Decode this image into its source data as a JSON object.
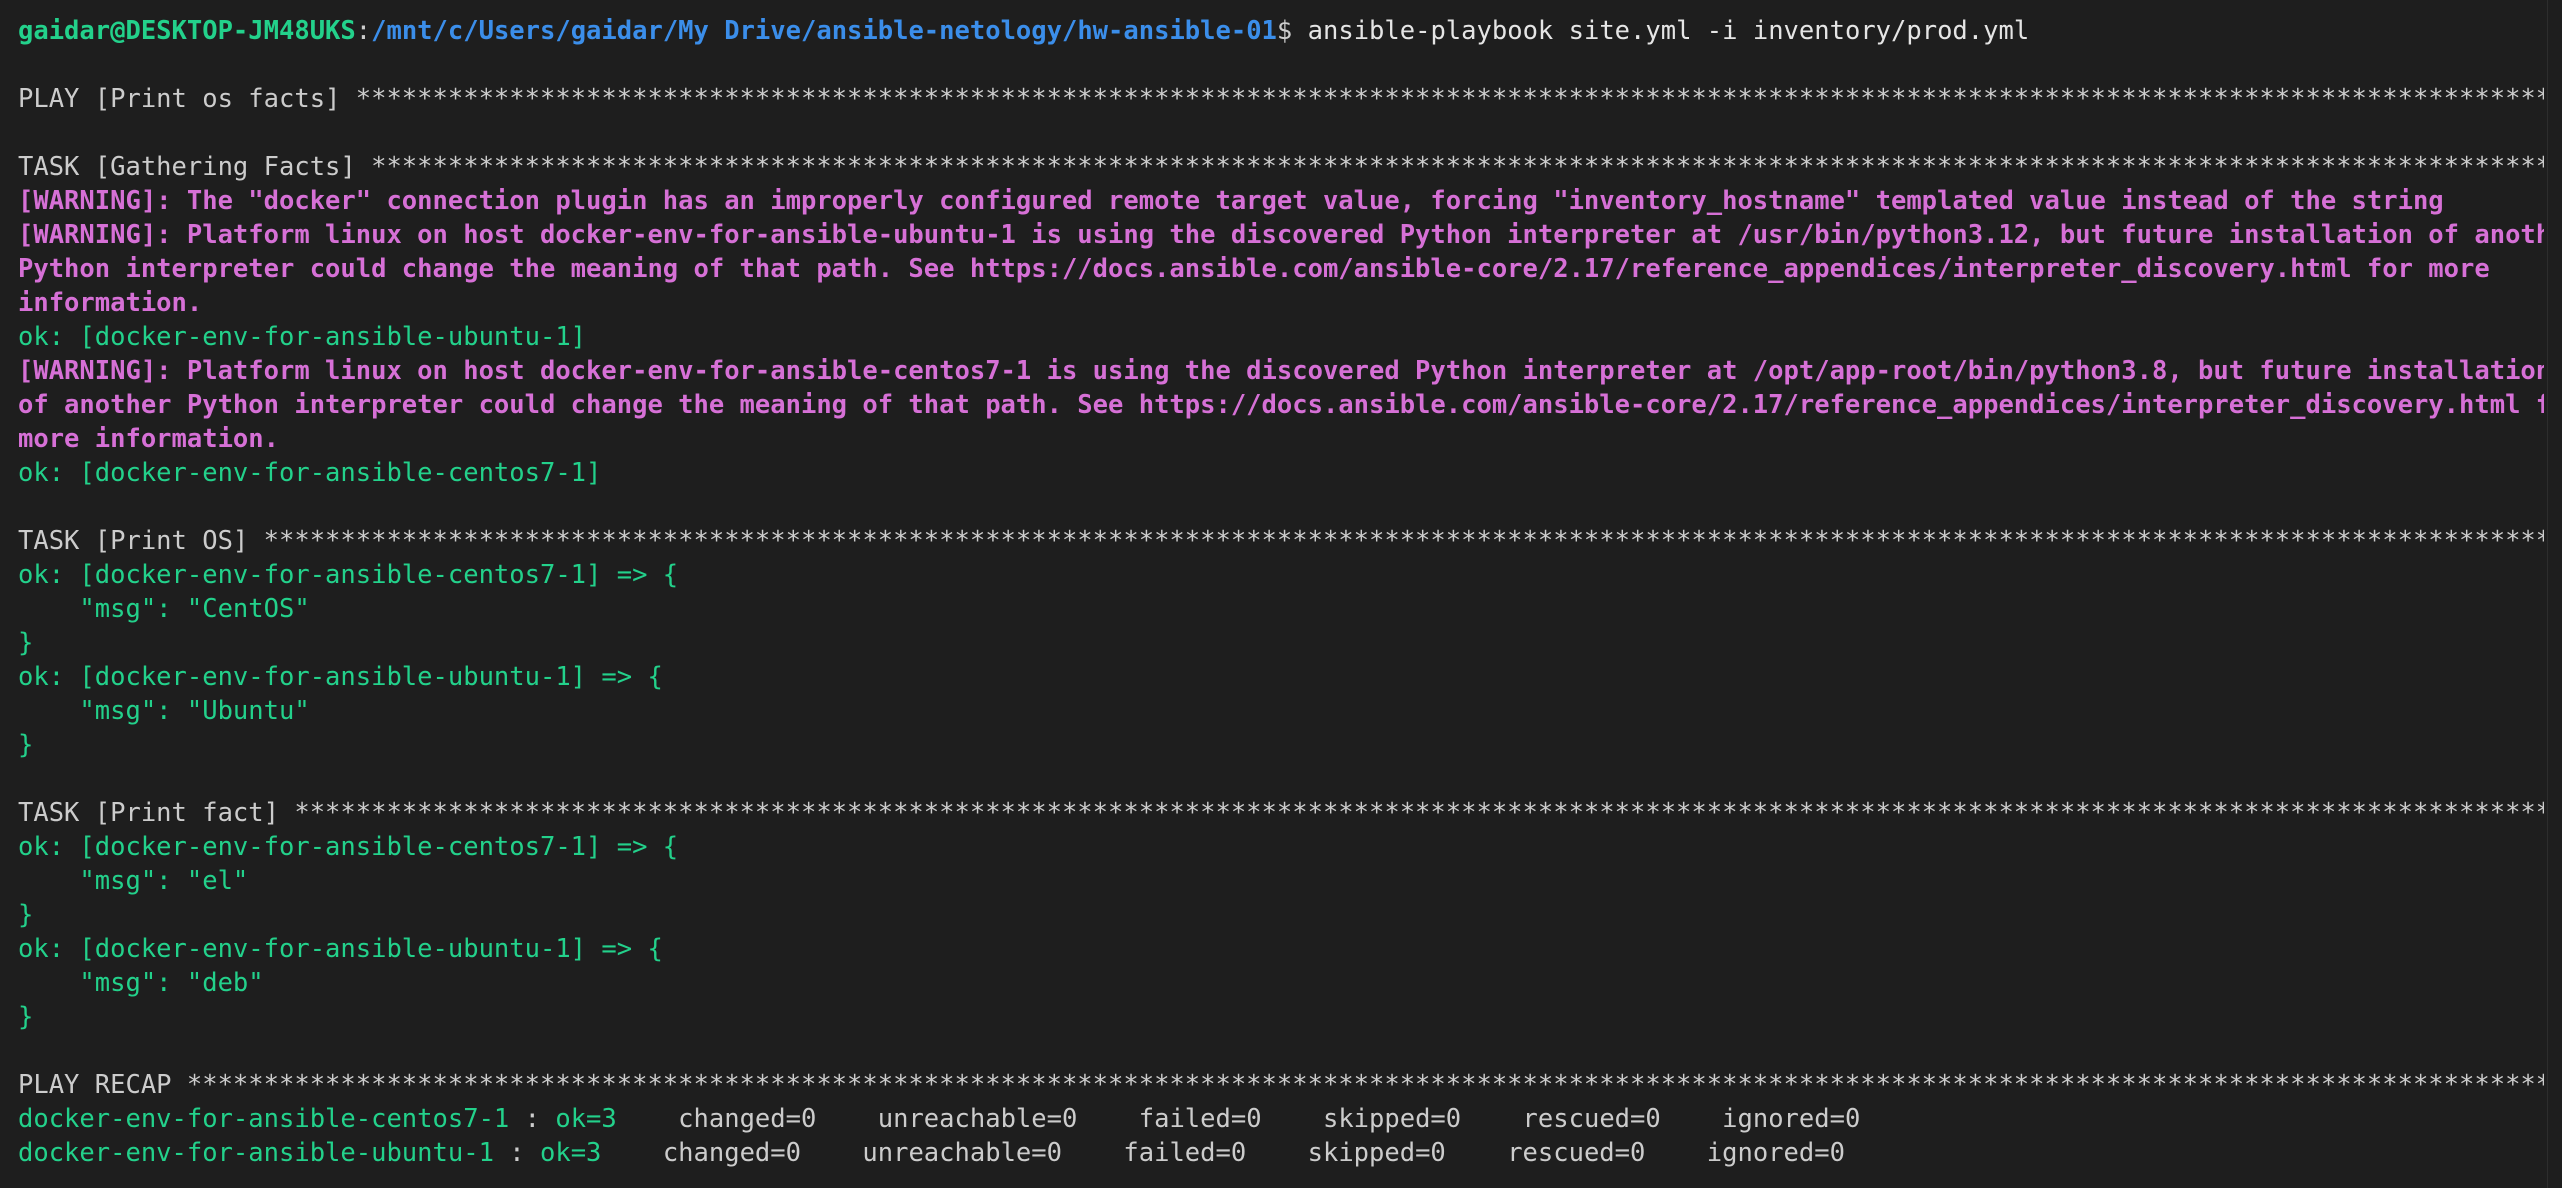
{
  "prompt": {
    "user_host": "gaidar@DESKTOP-JM48UKS",
    "colon": ":",
    "path": "/mnt/c/Users/gaidar/My Drive/ansible-netology/hw-ansible-01",
    "dollar": "$",
    "command": " ansible-playbook site.yml -i inventory/prod.yml"
  },
  "play_header": "PLAY [Print os facts] ********************************************************************************************************************************************************************************************",
  "task_gather_header": "TASK [Gathering Facts] *******************************************************************************************************************************************************************************************",
  "warn_docker": "[WARNING]: The \"docker\" connection plugin has an improperly configured remote target value, forcing \"inventory_hostname\" templated value instead of the string",
  "warn_ubuntu_1": "[WARNING]: Platform linux on host docker-env-for-ansible-ubuntu-1 is using the discovered Python interpreter at /usr/bin/python3.12, but future installation of another",
  "warn_ubuntu_2": "Python interpreter could change the meaning of that path. See https://docs.ansible.com/ansible-core/2.17/reference_appendices/interpreter_discovery.html for more",
  "warn_ubuntu_3": "information.",
  "ok_ubuntu_gather": "ok: [docker-env-for-ansible-ubuntu-1]",
  "warn_centos_1": "[WARNING]: Platform linux on host docker-env-for-ansible-centos7-1 is using the discovered Python interpreter at /opt/app-root/bin/python3.8, but future installation",
  "warn_centos_2": "of another Python interpreter could change the meaning of that path. See https://docs.ansible.com/ansible-core/2.17/reference_appendices/interpreter_discovery.html for",
  "warn_centos_3": "more information.",
  "ok_centos_gather": "ok: [docker-env-for-ansible-centos7-1]",
  "task_print_os_header": "TASK [Print OS] **************************************************************************************************************************************************************************************************",
  "print_os": {
    "centos_open": "ok: [docker-env-for-ansible-centos7-1] => {",
    "centos_msg": "    \"msg\": \"CentOS\"",
    "centos_close": "}",
    "ubuntu_open": "ok: [docker-env-for-ansible-ubuntu-1] => {",
    "ubuntu_msg": "    \"msg\": \"Ubuntu\"",
    "ubuntu_close": "}"
  },
  "task_print_fact_header": "TASK [Print fact] ************************************************************************************************************************************************************************************************",
  "print_fact": {
    "centos_open": "ok: [docker-env-for-ansible-centos7-1] => {",
    "centos_msg": "    \"msg\": \"el\"",
    "centos_close": "}",
    "ubuntu_open": "ok: [docker-env-for-ansible-ubuntu-1] => {",
    "ubuntu_msg": "    \"msg\": \"deb\"",
    "ubuntu_close": "}"
  },
  "recap_header": "PLAY RECAP *******************************************************************************************************************************************************************************************************",
  "recap": {
    "centos_host": "docker-env-for-ansible-centos7-1",
    "centos_sep": " : ",
    "centos_ok": "ok=3",
    "centos_rest": "    changed=0    unreachable=0    failed=0    skipped=0    rescued=0    ignored=0",
    "ubuntu_host": "docker-env-for-ansible-ubuntu-1",
    "ubuntu_sep": " : ",
    "ubuntu_ok": "ok=3",
    "ubuntu_rest": "    changed=0    unreachable=0    failed=0    skipped=0    rescued=0    ignored=0"
  },
  "colors": {
    "background": "#1e1e1e",
    "green": "#23d18b",
    "blue": "#3b8eea",
    "magenta": "#d670d6",
    "white": "#e5e5e5"
  }
}
